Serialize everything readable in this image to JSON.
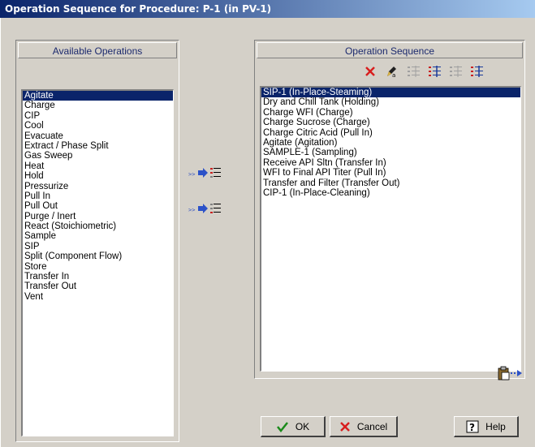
{
  "window": {
    "title": "Operation Sequence for Procedure: P-1 (in PV-1)"
  },
  "available": {
    "header": "Available Operations",
    "selected_index": 0,
    "items": [
      "Agitate",
      "Charge",
      "CIP",
      "Cool",
      "Evacuate",
      "Extract / Phase Split",
      "Gas Sweep",
      "Heat",
      "Hold",
      "Pressurize",
      "Pull In",
      "Pull Out",
      "Purge / Inert",
      "React (Stoichiometric)",
      "Sample",
      "SIP",
      "Split (Component Flow)",
      "Store",
      "Transfer In",
      "Transfer Out",
      "Vent"
    ]
  },
  "sequence": {
    "header": "Operation Sequence",
    "selected_index": 0,
    "items": [
      "SIP-1 (In-Place-Steaming)",
      "Dry and Chill Tank (Holding)",
      "Charge WFI (Charge)",
      "Charge Sucrose (Charge)",
      "Charge Citric Acid (Pull In)",
      "Agitate (Agitation)",
      "SAMPLE-1 (Sampling)",
      "Receive API Sltn (Transfer In)",
      "WFI to Final API Titer (Pull In)",
      "Transfer and Filter (Transfer Out)",
      "CIP-1 (In-Place-Cleaning)"
    ]
  },
  "toolbar_icons": [
    "delete-icon",
    "edit-icon",
    "move-up-icon",
    "move-down-icon",
    "move-first-icon",
    "move-last-icon"
  ],
  "buttons": {
    "ok": "OK",
    "cancel": "Cancel",
    "help": "Help"
  },
  "colors": {
    "selection": "#0a246a",
    "title_start": "#0a246a",
    "title_end": "#a6caf0",
    "delete_red": "#d81e1e"
  }
}
